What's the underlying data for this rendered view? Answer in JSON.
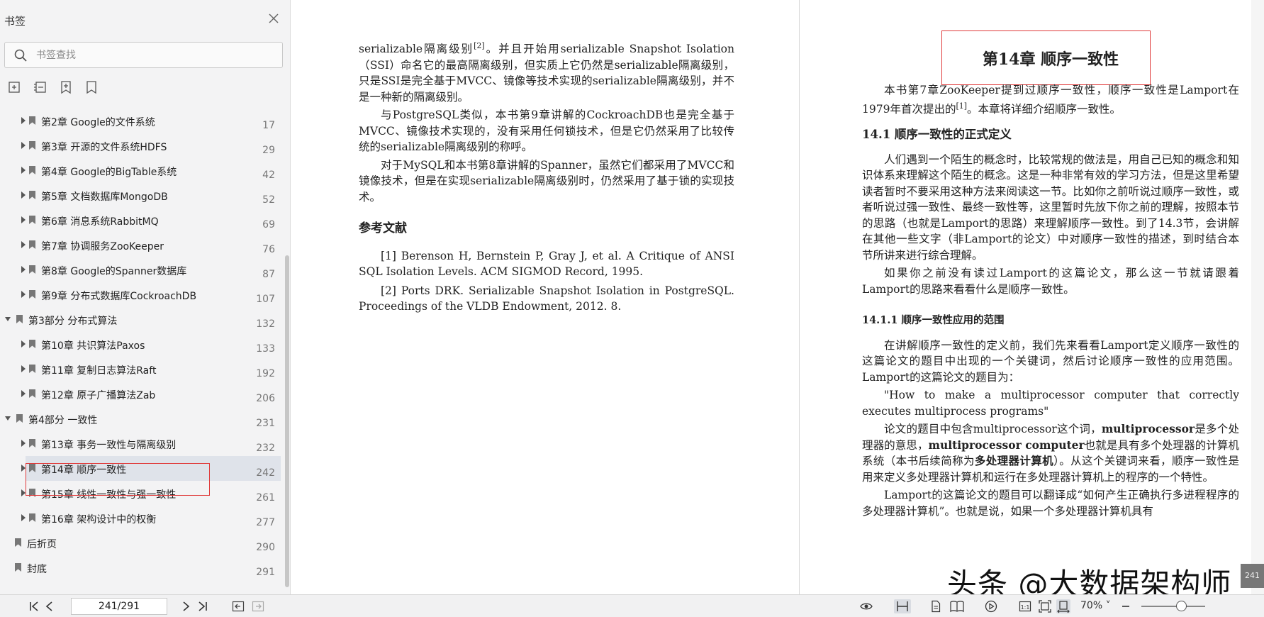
{
  "sidebar": {
    "title": "书签",
    "search_placeholder": "书签查找",
    "tools": [
      "add-bookmark-icon",
      "expand-all-icon",
      "bookmark-add-icon",
      "bookmark-icon"
    ],
    "items": [
      {
        "label": "第2章 Google的文件系统",
        "page": "17",
        "level": 1
      },
      {
        "label": "第3章 开源的文件系统HDFS",
        "page": "29",
        "level": 1
      },
      {
        "label": "第4章 Google的BigTable系统",
        "page": "42",
        "level": 1
      },
      {
        "label": "第5章 文档数据库MongoDB",
        "page": "52",
        "level": 1
      },
      {
        "label": "第6章 消息系统RabbitMQ",
        "page": "69",
        "level": 1
      },
      {
        "label": "第7章 协调服务ZooKeeper",
        "page": "76",
        "level": 1
      },
      {
        "label": "第8章 Google的Spanner数据库",
        "page": "87",
        "level": 1
      },
      {
        "label": "第9章 分布式数据库CockroachDB",
        "page": "107",
        "level": 1
      },
      {
        "label": "第3部分 分布式算法",
        "page": "132",
        "level": 0
      },
      {
        "label": "第10章 共识算法Paxos",
        "page": "133",
        "level": 1
      },
      {
        "label": "第11章 复制日志算法Raft",
        "page": "192",
        "level": 1
      },
      {
        "label": "第12章 原子广播算法Zab",
        "page": "206",
        "level": 1
      },
      {
        "label": "第4部分 一致性",
        "page": "231",
        "level": 0
      },
      {
        "label": "第13章 事务一致性与隔离级别",
        "page": "232",
        "level": 1
      },
      {
        "label": "第14章 顺序一致性",
        "page": "242",
        "level": 1,
        "selected": true
      },
      {
        "label": "第15章 线性一致性与强一致性",
        "page": "261",
        "level": 1
      },
      {
        "label": "第16章 架构设计中的权衡",
        "page": "277",
        "level": 1
      },
      {
        "label": "后折页",
        "page": "290",
        "level": 0,
        "leaf": true
      },
      {
        "label": "封底",
        "page": "291",
        "level": 0,
        "leaf": true
      }
    ]
  },
  "left_page": {
    "p1": "serializable隔离级别",
    "p1_sup": "[2]",
    "p1_rest": "。并且开始用serializable Snapshot Isolation（SSI）命名它的最高隔离级别，但实质上它仍然是serializable隔离级别，只是SSI是完全基于MVCC、镜像等技术实现的serializable隔离级别，并不是一种新的隔离级别。",
    "p2": "与PostgreSQL类似，本书第9章讲解的CockroachDB也是完全基于MVCC、镜像技术实现的，没有采用任何锁技术，但是它仍然采用了比较传统的serializable隔离级别的称呼。",
    "p3": "对于MySQL和本书第8章讲解的Spanner，虽然它们都采用了MVCC和镜像技术，但是在实现serializable隔离级别时，仍然采用了基于锁的实现技术。",
    "ref_heading": "参考文献",
    "ref1": "[1] Berenson H, Bernstein P, Gray J, et al. A Critique of ANSI SQL Isolation Levels. ACM SIGMOD Record, 1995.",
    "ref2": "[2] Ports DRK. Serializable Snapshot Isolation in PostgreSQL. Proceedings of the VLDB Endowment, 2012. 8."
  },
  "right_page": {
    "chapter_title": "第14章  顺序一致性",
    "intro_a": "本书第7章ZooKeeper提到过顺序一致性，顺序一致性是Lamport在1979年首次提出的",
    "intro_sup": "[1]",
    "intro_b": "。本章将详细介绍顺序一致性。",
    "h_14_1": "14.1 顺序一致性的正式定义",
    "p_14_1_a": "人们遇到一个陌生的概念时，比较常规的做法是，用自己已知的概念和知识体系来理解这个陌生的概念。这是一种非常有效的学习方法，但是这里希望读者暂时不要采用这种方法来阅读这一节。比如你之前听说过顺序一致性，或者听说过强一致性、最终一致性等，这里暂时先放下你之前的理解，按照本节的思路（也就是Lamport的思路）来理解顺序一致性。到了14.3节，会讲解在其他一些文字（非Lamport的论文）中对顺序一致性的描述，到时结合本节所讲来进行综合理解。",
    "p_14_1_b": "如果你之前没有读过Lamport的这篇论文，那么这一节就请跟着Lamport的思路来看看什么是顺序一致性。",
    "h_14_1_1": "14.1.1 顺序一致性应用的范围",
    "p_14_1_1_a": "在讲解顺序一致性的定义前，我们先来看看Lamport定义顺序一致性的这篇论文的题目中出现的一个关键词，然后讨论顺序一致性的应用范围。Lamport的这篇论文的题目为：",
    "quote": "\"How to make a multiprocessor computer that correctly executes multiprocess programs\"",
    "p_14_1_1_b1": "论文的题目中包含multiprocessor这个词，",
    "p_14_1_1_b_bold1": "multiprocessor",
    "p_14_1_1_b2": "是多个处理器的意思，",
    "p_14_1_1_b_bold2": "multiprocessor computer",
    "p_14_1_1_b3": "也就是具有多个处理器的计算机系统（本书后续简称为",
    "p_14_1_1_b_bold3": "多处理器计算机",
    "p_14_1_1_b4": "）。从这个关键词来看，顺序一致性是用来定义多处理器计算机和运行在多处理器计算机上的程序的一个特性。",
    "p_14_1_1_c": "Lamport的这篇论文的题目可以翻译成“如何产生正确执行多进程程序的多处理器计算机”。也就是说，如果一个多处理器计算机具有"
  },
  "watermark": "头条 @大数据架构师",
  "corner_badge": "241",
  "toolbar": {
    "page_value": "241/291",
    "zoom": "70%"
  }
}
